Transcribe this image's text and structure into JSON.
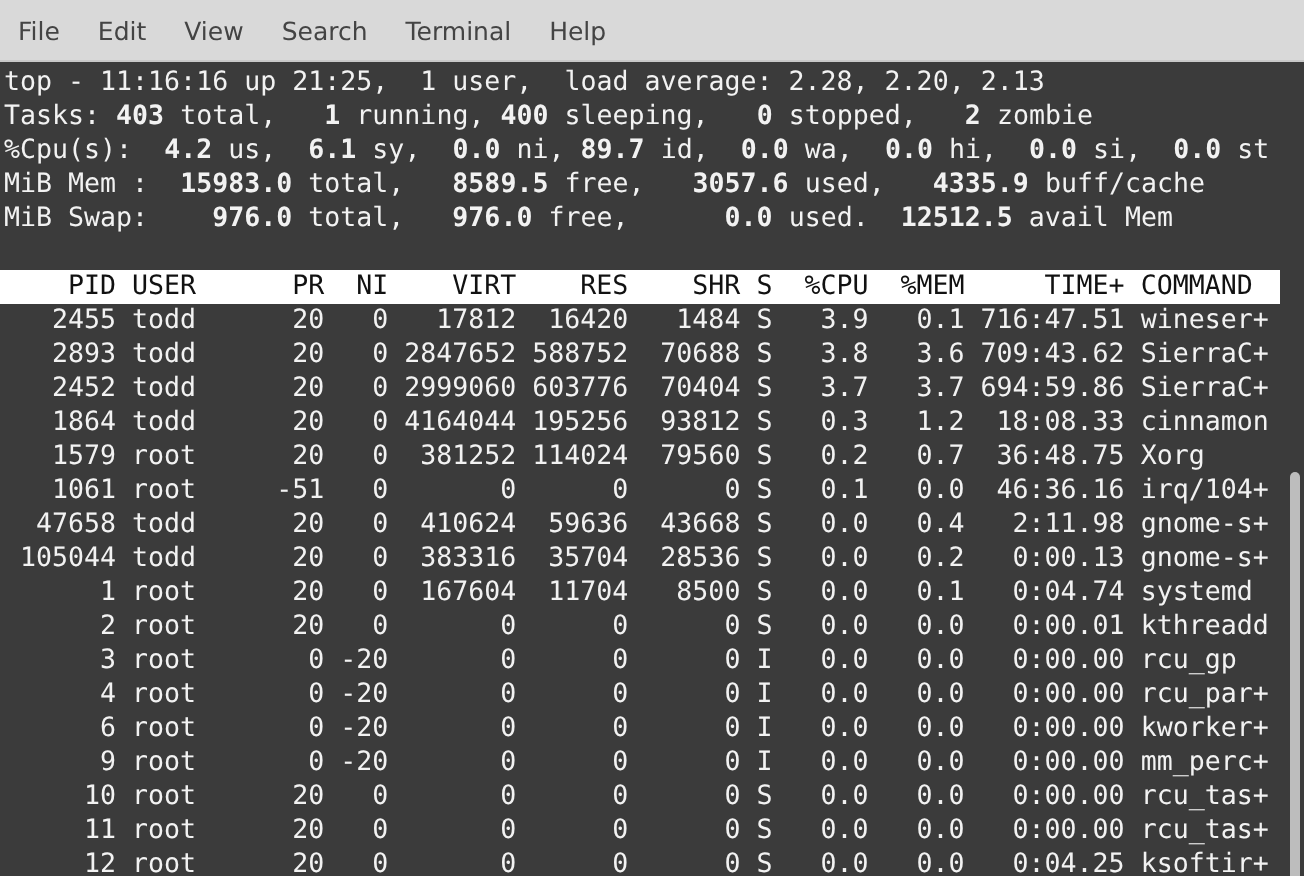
{
  "menu": [
    "File",
    "Edit",
    "View",
    "Search",
    "Terminal",
    "Help"
  ],
  "summary": [
    "top - 11:16:16 up 21:25,  1 user,  load average: 2.28, 2.20, 2.13",
    "Tasks: **403** total,   **1** running, **400** sleeping,   **0** stopped,   **2** zombie",
    "%Cpu(s):  **4.2** us,  **6.1** sy,  **0.0** ni, **89.7** id,  **0.0** wa,  **0.0** hi,  **0.0** si,  **0.0** st",
    "MiB Mem :  **15983.0** total,   **8589.5** free,   **3057.6** used,   **4335.9** buff/cache",
    "MiB Swap:    **976.0** total,   **976.0** free,      **0.0** used.  **12512.5** avail Mem"
  ],
  "table": {
    "columns": [
      "PID",
      "USER",
      "PR",
      "NI",
      "VIRT",
      "RES",
      "SHR",
      "S",
      "%CPU",
      "%MEM",
      "TIME+",
      "COMMAND"
    ],
    "rows": [
      [
        "2455",
        "todd",
        "20",
        "0",
        "17812",
        "16420",
        "1484",
        "S",
        "3.9",
        "0.1",
        "716:47.51",
        "wineser+"
      ],
      [
        "2893",
        "todd",
        "20",
        "0",
        "2847652",
        "588752",
        "70688",
        "S",
        "3.8",
        "3.6",
        "709:43.62",
        "SierraC+"
      ],
      [
        "2452",
        "todd",
        "20",
        "0",
        "2999060",
        "603776",
        "70404",
        "S",
        "3.7",
        "3.7",
        "694:59.86",
        "SierraC+"
      ],
      [
        "1864",
        "todd",
        "20",
        "0",
        "4164044",
        "195256",
        "93812",
        "S",
        "0.3",
        "1.2",
        "18:08.33",
        "cinnamon"
      ],
      [
        "1579",
        "root",
        "20",
        "0",
        "381252",
        "114024",
        "79560",
        "S",
        "0.2",
        "0.7",
        "36:48.75",
        "Xorg"
      ],
      [
        "1061",
        "root",
        "-51",
        "0",
        "0",
        "0",
        "0",
        "S",
        "0.1",
        "0.0",
        "46:36.16",
        "irq/104+"
      ],
      [
        "47658",
        "todd",
        "20",
        "0",
        "410624",
        "59636",
        "43668",
        "S",
        "0.0",
        "0.4",
        "2:11.98",
        "gnome-s+"
      ],
      [
        "105044",
        "todd",
        "20",
        "0",
        "383316",
        "35704",
        "28536",
        "S",
        "0.0",
        "0.2",
        "0:00.13",
        "gnome-s+"
      ],
      [
        "1",
        "root",
        "20",
        "0",
        "167604",
        "11704",
        "8500",
        "S",
        "0.0",
        "0.1",
        "0:04.74",
        "systemd"
      ],
      [
        "2",
        "root",
        "20",
        "0",
        "0",
        "0",
        "0",
        "S",
        "0.0",
        "0.0",
        "0:00.01",
        "kthreadd"
      ],
      [
        "3",
        "root",
        "0",
        "-20",
        "0",
        "0",
        "0",
        "I",
        "0.0",
        "0.0",
        "0:00.00",
        "rcu_gp"
      ],
      [
        "4",
        "root",
        "0",
        "-20",
        "0",
        "0",
        "0",
        "I",
        "0.0",
        "0.0",
        "0:00.00",
        "rcu_par+"
      ],
      [
        "6",
        "root",
        "0",
        "-20",
        "0",
        "0",
        "0",
        "I",
        "0.0",
        "0.0",
        "0:00.00",
        "kworker+"
      ],
      [
        "9",
        "root",
        "0",
        "-20",
        "0",
        "0",
        "0",
        "I",
        "0.0",
        "0.0",
        "0:00.00",
        "mm_perc+"
      ],
      [
        "10",
        "root",
        "20",
        "0",
        "0",
        "0",
        "0",
        "S",
        "0.0",
        "0.0",
        "0:00.00",
        "rcu_tas+"
      ],
      [
        "11",
        "root",
        "20",
        "0",
        "0",
        "0",
        "0",
        "S",
        "0.0",
        "0.0",
        "0:00.00",
        "rcu_tas+"
      ],
      [
        "12",
        "root",
        "20",
        "0",
        "0",
        "0",
        "0",
        "S",
        "0.0",
        "0.0",
        "0:04.25",
        "ksoftir+"
      ]
    ]
  }
}
